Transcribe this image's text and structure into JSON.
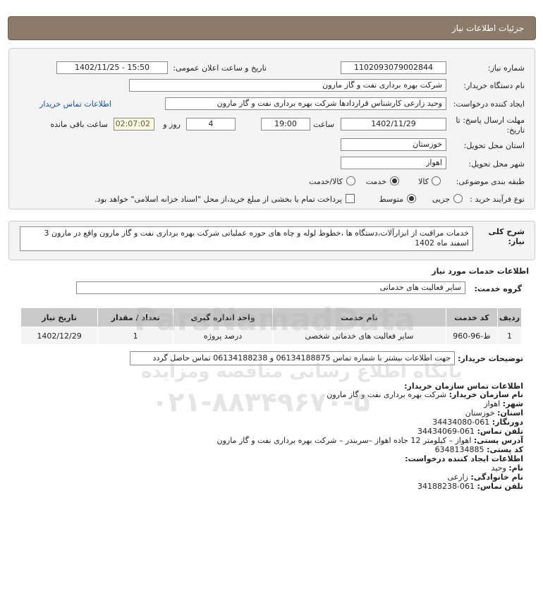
{
  "header": {
    "title": "جزئیات اطلاعات نیاز"
  },
  "form": {
    "need_number_label": "شماره نیاز:",
    "need_number": "1102093079002844",
    "announce_label": "تاریخ و ساعت اعلان عمومی:",
    "announce_value": "1402/11/25 - 15:50",
    "buyer_org_label": "نام دستگاه خریدار:",
    "buyer_org": "شرکت بهره برداری نفت و گاز مارون",
    "creator_label": "ایجاد کننده درخواست:",
    "creator": "وحید زارعی کارشناس قراردادها شرکت بهره برداری نفت و گاز مارون",
    "buyer_contact_link": "اطلاعات تماس خریدار",
    "deadline_label_1": "مهلت ارسال پاسخ: تا",
    "deadline_label_2": "تاریخ:",
    "deadline_date": "1402/11/29",
    "time_label": "ساعت",
    "deadline_time": "19:00",
    "days_value": "4",
    "days_label": "روز و",
    "remaining_time": "02:07:02",
    "remaining_label": "ساعت باقی مانده",
    "province_label": "استان محل تحویل:",
    "province": "خوزستان",
    "city_label": "شهر محل تحویل:",
    "city": "اهواز",
    "category_label": "طبقه بندی موضوعی:",
    "category_options": [
      "کالا",
      "خدمت",
      "کالا/خدمت"
    ],
    "category_selected": "خدمت",
    "process_label": "نوع فرآیند خرید :",
    "process_options": [
      "جزیی",
      "متوسط"
    ],
    "process_selected": "متوسط",
    "payment_note": "پرداخت تمام یا بخشی از مبلغ خرید،از محل \"اسناد خزانه اسلامی\" خواهد بود."
  },
  "description": {
    "label_1": "شرح کلی",
    "label_2": "نیاز:",
    "text": "خدمات مراقبت از ابزارآلات،دستگاه ها ،خطوط لوله و چاه های حوزه عملیاتی شرکت بهره برداری نفت و گاز مارون واقع در مارون 3 اسفند ماه 1402"
  },
  "services": {
    "section_title": "اطلاعات خدمات مورد نیاز",
    "group_label": "گروه خدمت:",
    "group_value": "سایر فعالیت های خدماتی",
    "columns": [
      "ردیف",
      "کد خدمت",
      "نام خدمت",
      "واحد اندازه گیری",
      "تعداد / مقدار",
      "تاریخ نیاز"
    ],
    "rows": [
      [
        "1",
        "ط-96-960",
        "سایر فعالیت های خدماتی شخصی",
        "درصد پروژه",
        "1",
        "1402/12/29"
      ]
    ]
  },
  "buyer_notes": {
    "label": "توضیحات خریدار:",
    "text": "جهت اطلاعات بیشتر با شماره تماس 06134188875 و 06134188238 تماس حاصل گردد"
  },
  "contact": {
    "title": "اطلاعات تماس سازمان خریدار:",
    "org_label": "نام سازمان خریدار:",
    "org": "شرکت بهره برداری نفت و گاز مارون",
    "city_label": "شهر:",
    "city": "اهواز",
    "province_label": "استان:",
    "province": "خوزستان",
    "fax_label": "دورنگار:",
    "fax": "061-34434080",
    "phone_label": "تلفن تماس:",
    "phone": "061-34434069",
    "address_label": "آدرس پستی:",
    "address": "اهواز – کیلومتر 12 جاده اهواز –سربندر – شرکت بهره برداری نفت و گاز مارون",
    "postal_label": "کد پستی:",
    "postal": "6348134885",
    "creator_title": "اطلاعات ایجاد کننده درخواست:",
    "first_name_label": "نام:",
    "first_name": "وحید",
    "last_name_label": "نام خانوادگی:",
    "last_name": "زارعی",
    "creator_phone_label": "تلفن تماس:",
    "creator_phone": "061-34188238"
  },
  "watermark": {
    "text_1": "ParsNamadData",
    "text_2": "پایگاه اطلاع رسانی مناقصه ومزایده",
    "text_3": "۰۲۱-۸۸۳۴۹۶۷۰-۵"
  }
}
